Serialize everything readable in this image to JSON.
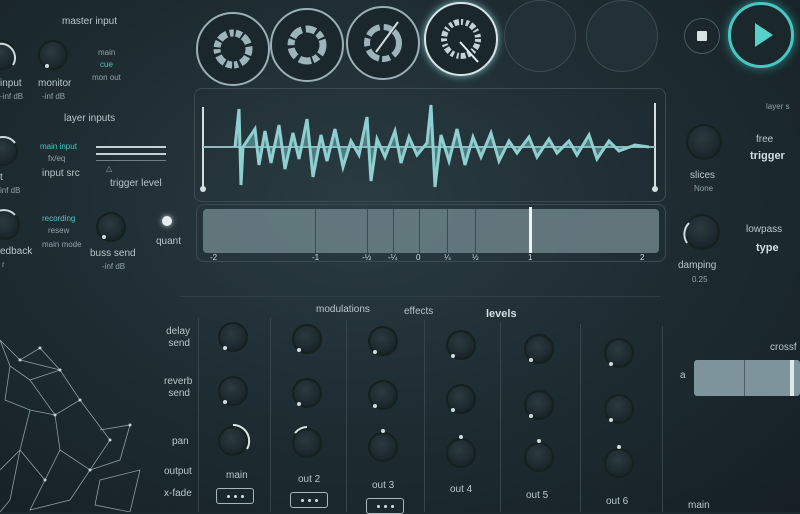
{
  "master_input": {
    "title": "master input",
    "input_label": "input",
    "input_value": "-inf dB",
    "monitor_label": "monitor",
    "monitor_value": "-inf dB",
    "monitor_options": [
      "main",
      "cue",
      "mon out"
    ],
    "selected_monitor": "cue"
  },
  "layer_inputs": {
    "title": "layer inputs",
    "input_src_options": [
      "main input",
      "fx/eq"
    ],
    "input_src_label": "input src",
    "trigger_level_label": "trigger level",
    "left_label": "t",
    "left_value": "inf dB",
    "feedback_label": "edback",
    "feedback_value": "r",
    "mode_options": [
      "recording",
      "resew",
      "main mode"
    ],
    "buss_send_label": "buss send",
    "buss_send_value": "-inf dB",
    "quant_label": "quant"
  },
  "transport": {
    "stop_label": "stop",
    "play_label": "play"
  },
  "waveform": {
    "ruler_labels": [
      "-2",
      "-1",
      "-½",
      "-¼",
      "0",
      "¼",
      "½",
      "1",
      "2"
    ]
  },
  "right_controls": {
    "layer_label": "layer s",
    "slices_label": "slices",
    "slices_value": "None",
    "free_label": "free",
    "trigger_label": "trigger",
    "damping_label": "damping",
    "damping_value": "0.25",
    "lowpass_label": "lowpass",
    "type_label": "type",
    "crossfader_label": "crossf",
    "a_label": "a",
    "main_label": "main"
  },
  "mixer": {
    "tabs": [
      "modulations",
      "effects",
      "levels"
    ],
    "selected_tab": "levels",
    "row_labels": [
      "delay send",
      "reverb send",
      "pan",
      "output",
      "x-fade"
    ],
    "channels": [
      "main",
      "out 2",
      "out 3",
      "out 4",
      "out 5",
      "out 6"
    ]
  }
}
